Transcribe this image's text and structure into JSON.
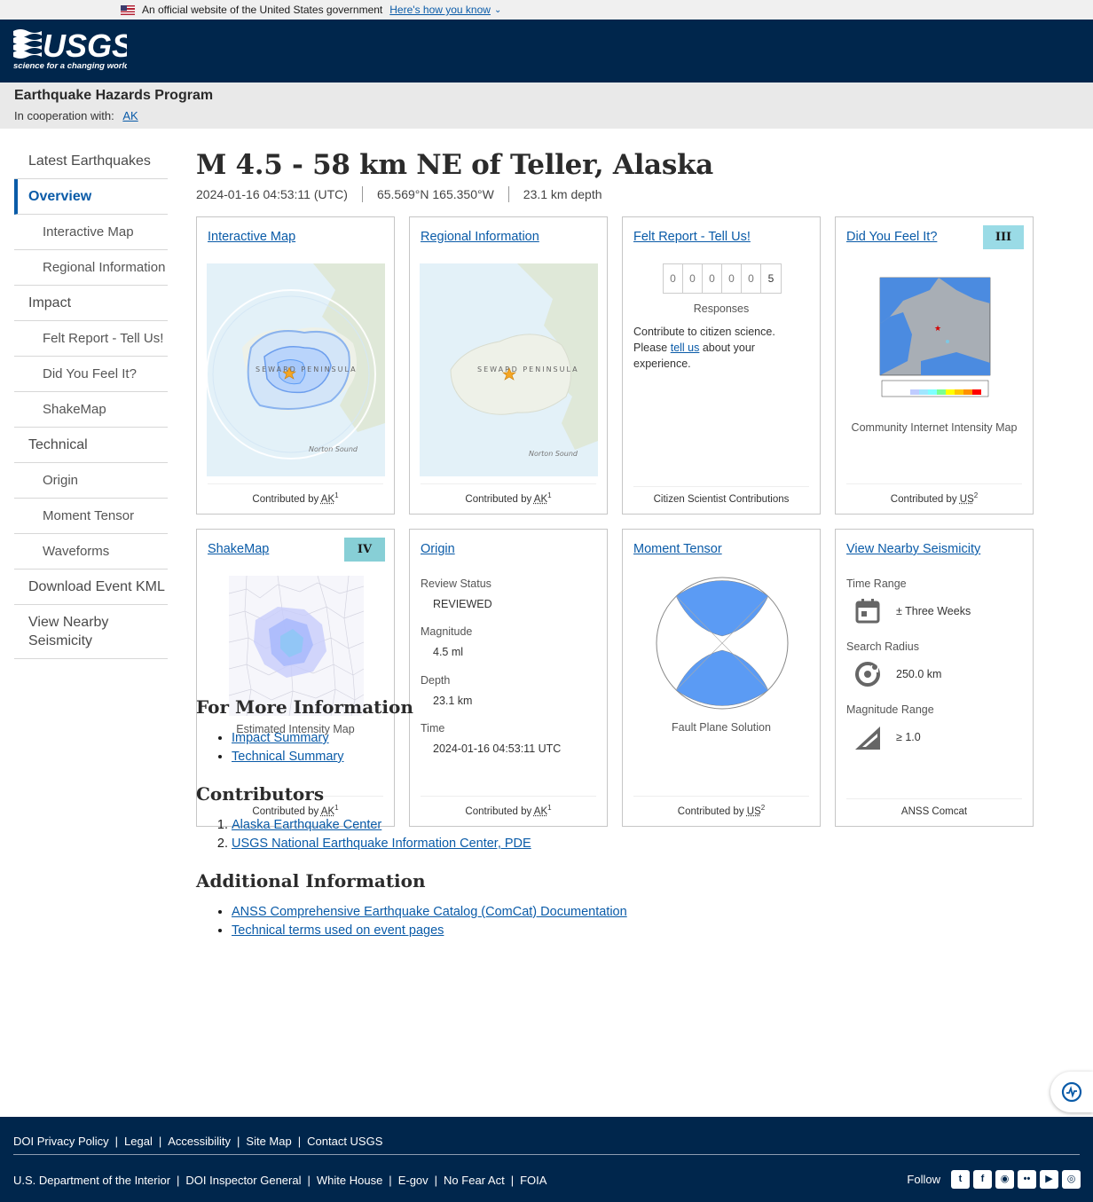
{
  "gov_banner": {
    "text": "An official website of the United States government",
    "how_link": "Here's how you know"
  },
  "header": {
    "logo_text": "USGS",
    "logo_tagline": "science for a changing world"
  },
  "site": {
    "title": "Earthquake Hazards Program",
    "coop_label": "In cooperation with:",
    "coop_link": "AK"
  },
  "nav": {
    "items": [
      "Latest Earthquakes",
      "Overview",
      "Interactive Map",
      "Regional Information",
      "Impact",
      "Felt Report - Tell Us!",
      "Did You Feel It?",
      "ShakeMap",
      "Technical",
      "Origin",
      "Moment Tensor",
      "Waveforms",
      "Download Event KML",
      "View Nearby Seismicity"
    ]
  },
  "event": {
    "title": "M 4.5 - 58 km NE of Teller, Alaska",
    "time": "2024-01-16 04:53:11 (UTC)",
    "location": "65.569°N 165.350°W",
    "depth": "23.1 km depth"
  },
  "cards": {
    "interactive_map": {
      "title": "Interactive Map",
      "contrib_prefix": "Contributed by",
      "contrib": "AK",
      "sup": "1",
      "map_label": "SEWARD PENINSULA",
      "sound_label": "Norton Sound"
    },
    "regional": {
      "title": "Regional Information",
      "contrib_prefix": "Contributed by",
      "contrib": "AK",
      "sup": "1",
      "map_label": "SEWARD PENINSULA",
      "sound_label": "Norton Sound"
    },
    "felt": {
      "title": "Felt Report - Tell Us!",
      "digits": [
        "0",
        "0",
        "0",
        "0",
        "0",
        "5"
      ],
      "responses_label": "Responses",
      "text_before": "Contribute to citizen science. Please",
      "tell_link": "tell us",
      "text_after": "about your experience.",
      "footer": "Citizen Scientist Contributions"
    },
    "dyfi": {
      "title": "Did You Feel It?",
      "badge": "III",
      "badge_color": "#9adbe6",
      "caption": "Community Internet Intensity Map",
      "contrib_prefix": "Contributed by",
      "contrib": "US",
      "sup": "2"
    },
    "shakemap": {
      "title": "ShakeMap",
      "badge": "IV",
      "badge_color": "#87cfd6",
      "caption": "Estimated Intensity Map",
      "contrib_prefix": "Contributed by",
      "contrib": "AK",
      "sup": "1"
    },
    "origin": {
      "title": "Origin",
      "review_label": "Review Status",
      "review_value": "REVIEWED",
      "mag_label": "Magnitude",
      "mag_value": "4.5 ml",
      "depth_label": "Depth",
      "depth_value": "23.1 km",
      "time_label": "Time",
      "time_value": "2024-01-16 04:53:11 UTC",
      "contrib_prefix": "Contributed by",
      "contrib": "AK",
      "sup": "1"
    },
    "moment_tensor": {
      "title": "Moment Tensor",
      "caption": "Fault Plane Solution",
      "contrib_prefix": "Contributed by",
      "contrib": "US",
      "sup": "2"
    },
    "nearby": {
      "title": "View Nearby Seismicity",
      "time_label": "Time Range",
      "time_value": "± Three Weeks",
      "radius_label": "Search Radius",
      "radius_value": "250.0 km",
      "mag_label": "Magnitude Range",
      "mag_value": "≥ 1.0",
      "footer": "ANSS Comcat"
    }
  },
  "more_info": {
    "heading": "For More Information",
    "links": [
      "Impact Summary",
      "Technical Summary"
    ]
  },
  "contributors": {
    "heading": "Contributors",
    "links": [
      "Alaska Earthquake Center",
      "USGS National Earthquake Information Center, PDE"
    ]
  },
  "additional": {
    "heading": "Additional Information",
    "links": [
      "ANSS Comprehensive Earthquake Catalog (ComCat) Documentation",
      "Technical terms used on event pages"
    ]
  },
  "footer": {
    "row1": [
      "DOI Privacy Policy",
      "Legal",
      "Accessibility",
      "Site Map",
      "Contact USGS"
    ],
    "row2": [
      "U.S. Department of the Interior",
      "DOI Inspector General",
      "White House",
      "E-gov",
      "No Fear Act",
      "FOIA"
    ],
    "follow_label": "Follow",
    "social_icons": [
      "twitter-icon",
      "facebook-icon",
      "github-icon",
      "flickr-icon",
      "youtube-icon",
      "instagram-icon"
    ]
  },
  "colors": {
    "usgs_navy": "#00264c",
    "link_blue": "#0a5ba8",
    "shade_blue": "#5b9bf4"
  }
}
